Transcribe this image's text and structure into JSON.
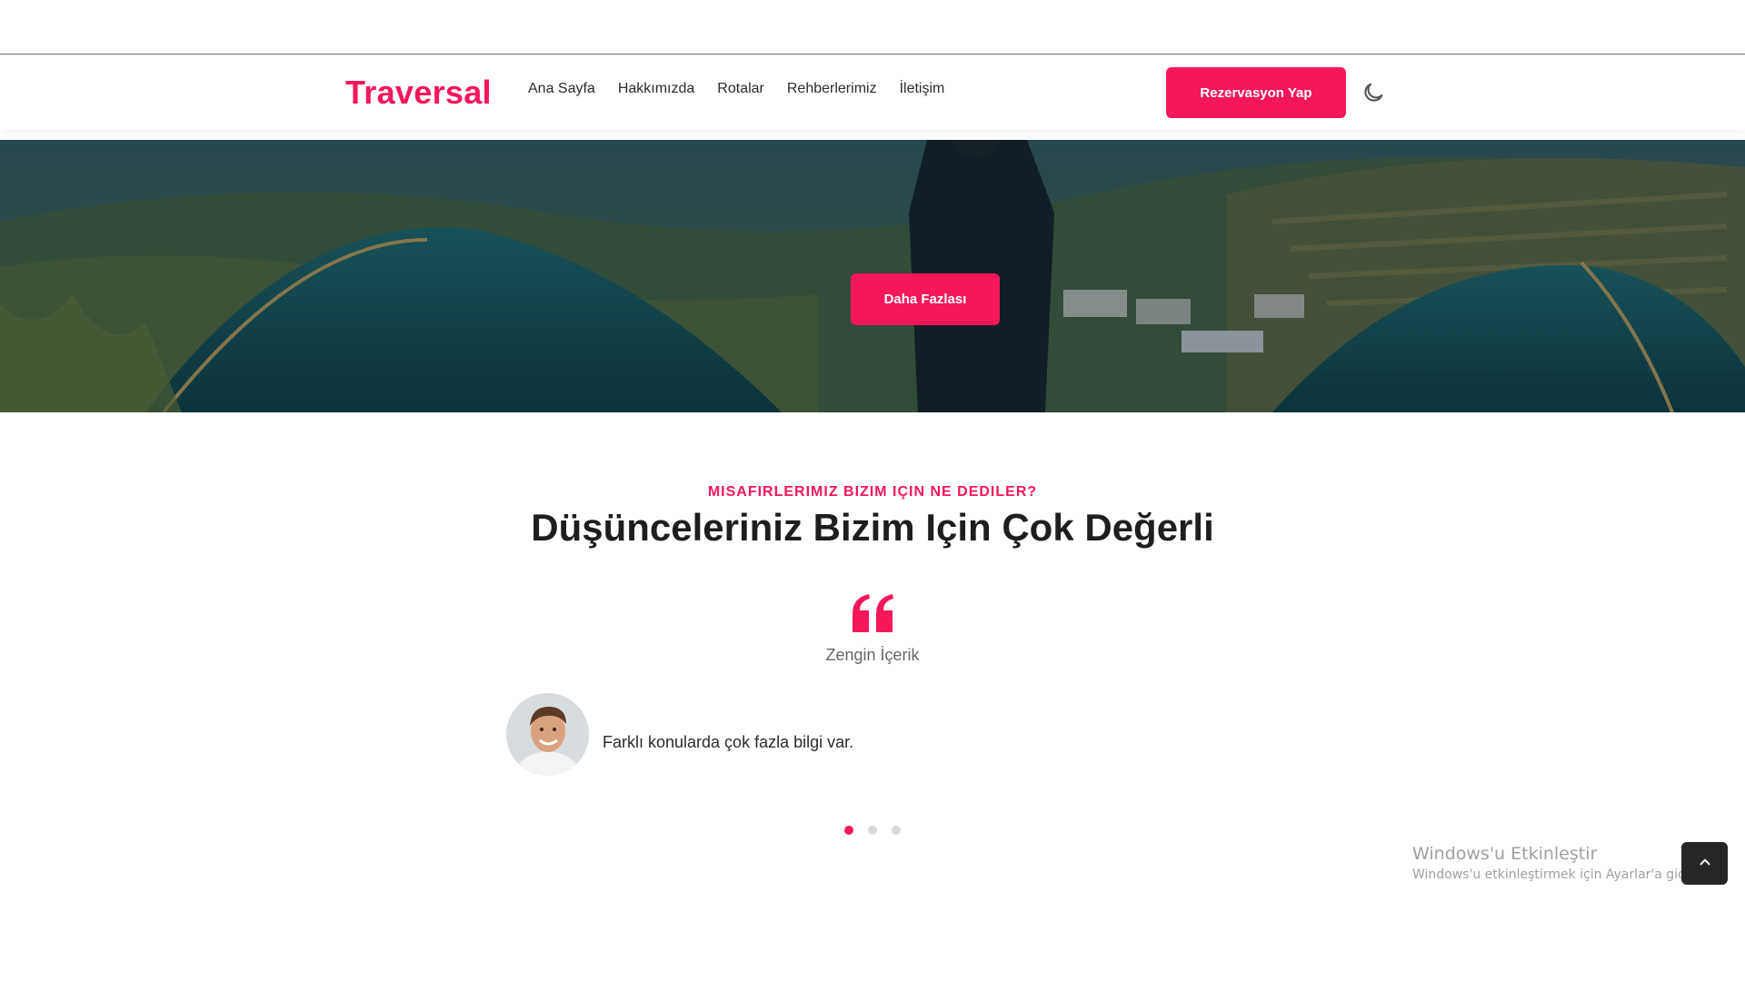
{
  "navbar": {
    "brand": "Traversal",
    "links": [
      "Ana Sayfa",
      "Hakkımızda",
      "Rotalar",
      "Rehberlerimiz",
      "İletişim"
    ],
    "reserve_label": "Rezervasyon Yap",
    "theme_icon": "moon-icon"
  },
  "hero": {
    "button_label": "Daha Fazlası"
  },
  "testimonials": {
    "subtitle": "MISAFIRLERIMIZ BIZIM IÇIN NE DEDILER?",
    "title": "Düşünceleriniz Bizim Için Çok Değerli",
    "quote_icon": "quote-icon",
    "item_title": "Zengin İçerik",
    "item_text": "Farklı konularda çok fazla bilgi var.",
    "active_index": 0,
    "total": 3
  },
  "watermark": {
    "title": "Windows'u Etkinleştir",
    "subtitle": "Windows'u etkinleştirmek için Ayarlar'a gidin."
  },
  "colors": {
    "accent": "#f5175a",
    "dark": "#262626"
  }
}
